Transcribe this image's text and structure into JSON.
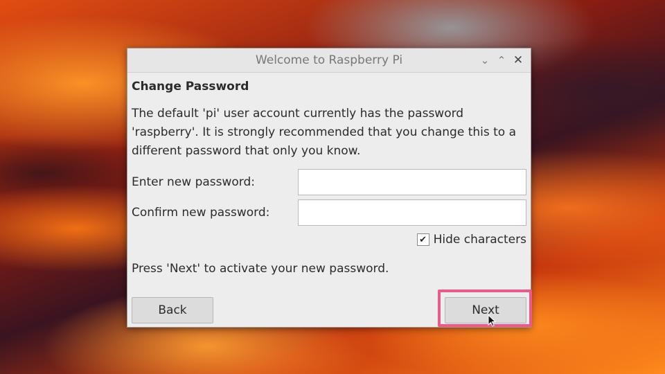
{
  "window": {
    "title": "Welcome to Raspberry Pi",
    "controls": [
      "minimize",
      "maximize",
      "close"
    ]
  },
  "page": {
    "heading": "Change Password",
    "description": "The default 'pi' user account currently has the password 'raspberry'. It is strongly recommended that you change this to a different password that only you know.",
    "new_password_label": "Enter new password:",
    "new_password_value": "",
    "confirm_password_label": "Confirm new password:",
    "confirm_password_value": "",
    "hide_characters_label": "Hide characters",
    "hide_characters_checked": true,
    "note": "Press 'Next' to activate your new password."
  },
  "buttons": {
    "back_label": "Back",
    "next_label": "Next"
  },
  "icons": {
    "minimize": "chevron-down-icon",
    "maximize": "chevron-up-icon",
    "close": "close-icon",
    "check": "checkmark-icon",
    "cursor": "mouse-pointer-icon"
  },
  "colors": {
    "highlight": "#ec5a8c"
  }
}
